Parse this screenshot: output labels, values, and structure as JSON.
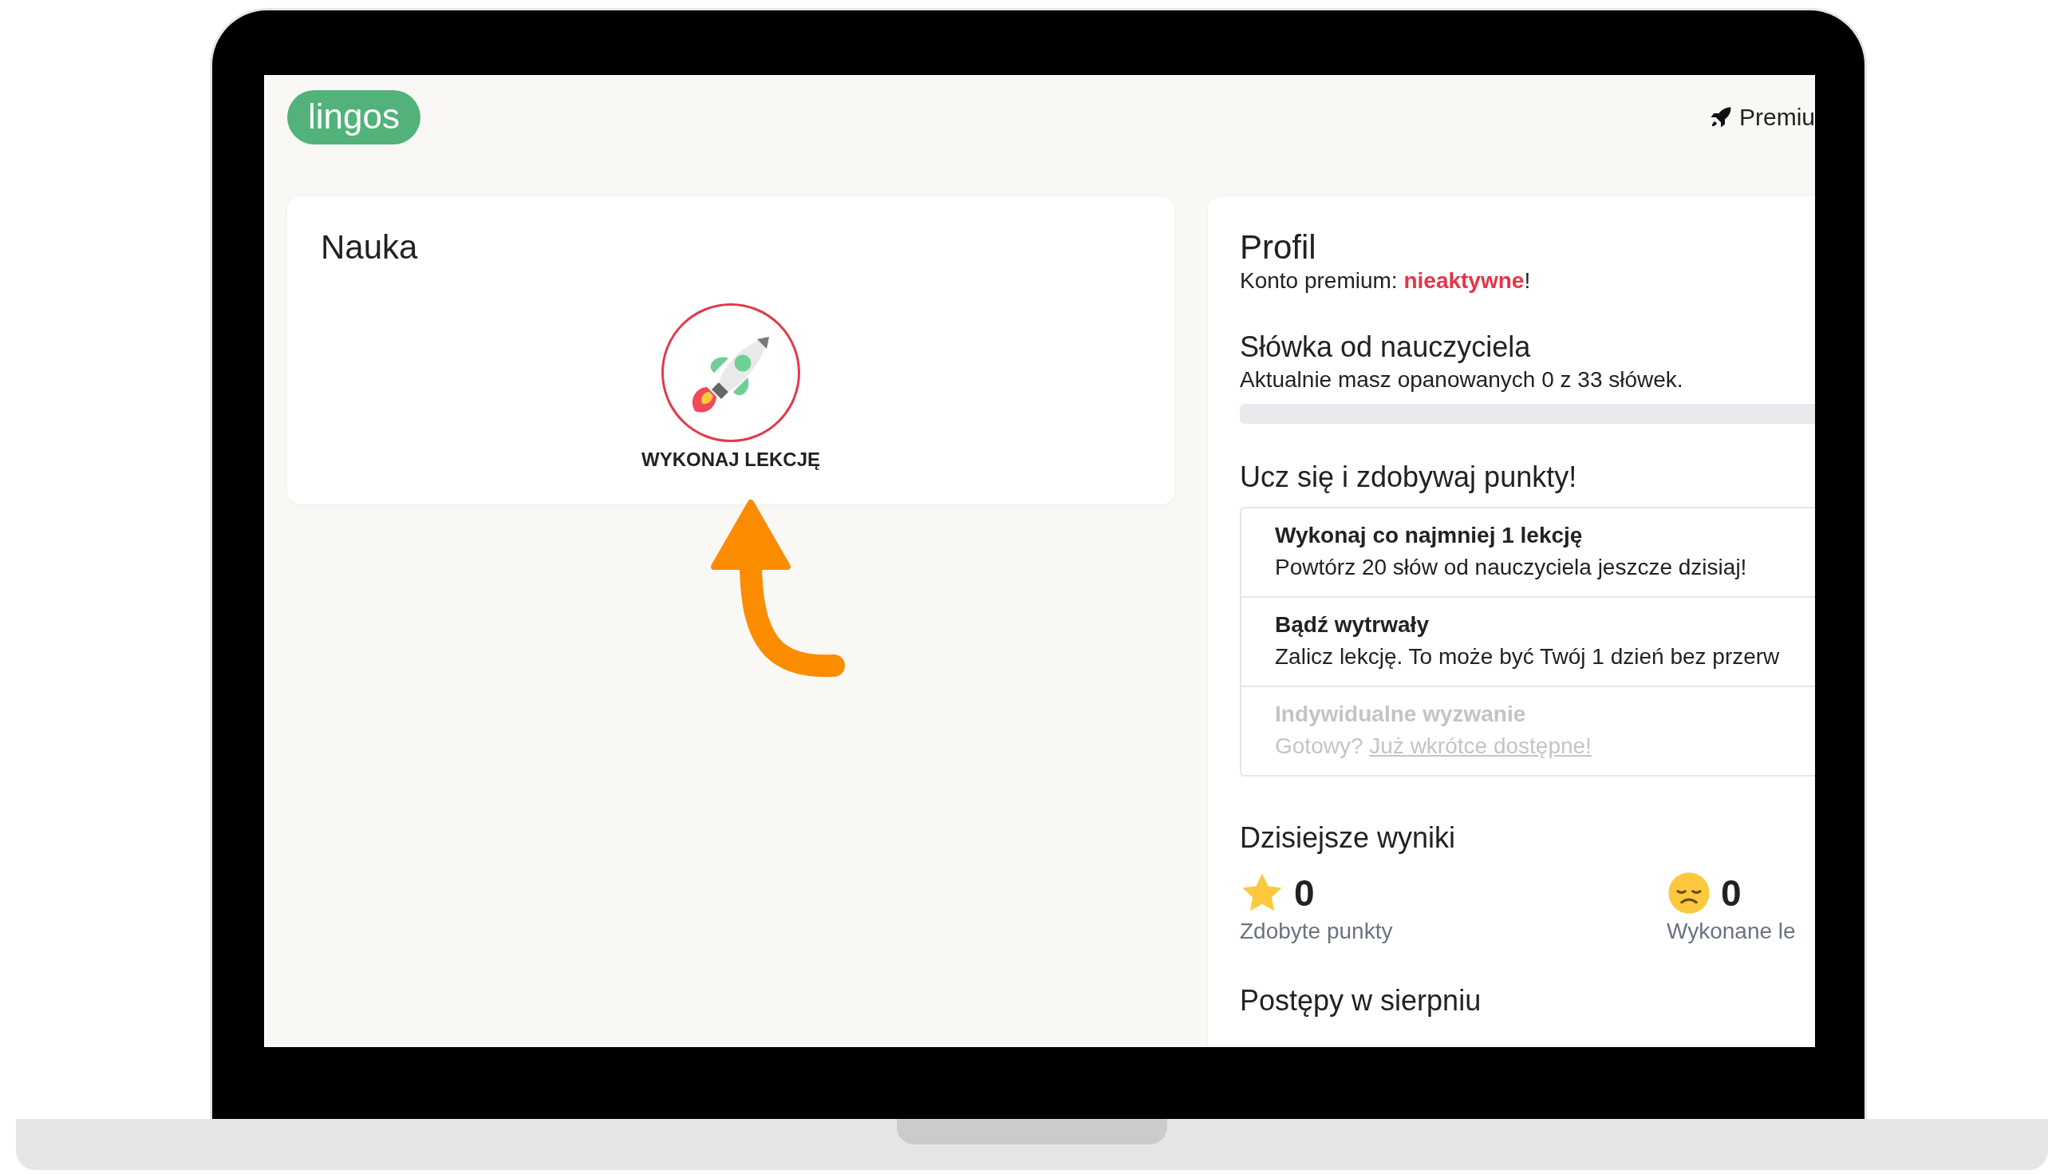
{
  "logo": "lingos",
  "header_link": {
    "label": "Premiu"
  },
  "learning_card": {
    "title": "Nauka",
    "action": "WYKONAJ LEKCJĘ"
  },
  "profile": {
    "title": "Profil",
    "premium_status": "Konto premium: **nieaktywne**!",
    "teacher_words": {
      "title": "Słówka od nauczyciela",
      "text": "Aktualnie masz opanowanych 0 z 33 słówek.",
      "level": 0
    },
    "challenges_title": "Ucz się i zdobywaj punkty!",
    "challenges": [
      {
        "title": "Wykonaj co najmniej 1 lekcję",
        "text": "Powtórz 20 słów od nauczyciela jeszcze dzisiaj!",
        "disabled": false
      },
      {
        "title": "Bądź wytrwały",
        "text": "Zalicz lekcję. To może być Twój 1 dzień bez przerw",
        "disabled": false
      },
      {
        "title": "Indywidualne wyzwanie",
        "text": "Gotowy?",
        "link": "Już wkrótce dostępne!",
        "disabled": true
      }
    ],
    "today": {
      "title": "Dzisiejsze wyniki",
      "stats": [
        {
          "kind": "points",
          "value": "0",
          "label": "Zdobyte punkty"
        },
        {
          "kind": "lessons",
          "value": "0",
          "label": "Wykonane le"
        }
      ]
    },
    "month_title": "Postępy w sierpniu"
  }
}
